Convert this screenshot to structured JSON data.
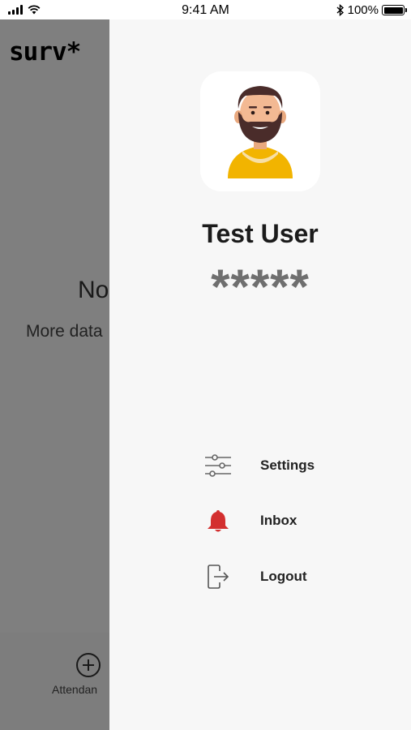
{
  "status_bar": {
    "time": "9:41 AM",
    "battery": "100%"
  },
  "background": {
    "logo": "surv*",
    "empty_title": "No",
    "empty_subtitle": "More data",
    "tab_label": "Attendan"
  },
  "drawer": {
    "user_name": "Test User",
    "rating": "*****",
    "menu": [
      {
        "label": "Settings",
        "icon": "sliders-icon"
      },
      {
        "label": "Inbox",
        "icon": "bell-icon"
      },
      {
        "label": "Logout",
        "icon": "logout-icon"
      }
    ]
  },
  "colors": {
    "scrim": "#7f7f7f",
    "drawer_bg": "#f7f7f7",
    "inbox_bell": "#d32f2f",
    "avatar_shirt": "#f2b400",
    "avatar_hair": "#4a2c2a"
  }
}
